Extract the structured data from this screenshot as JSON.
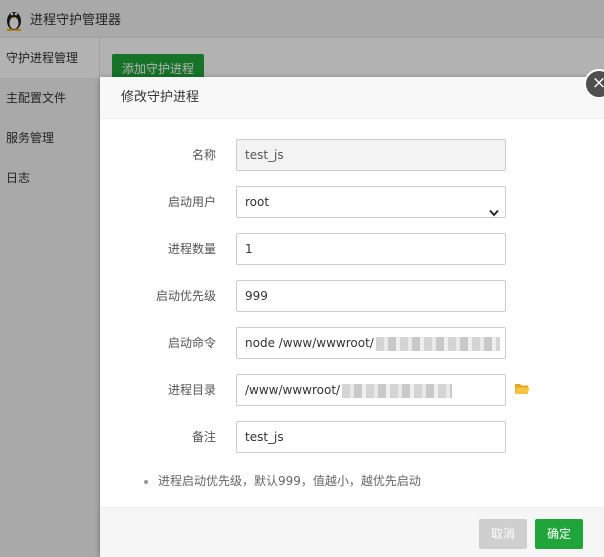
{
  "app": {
    "title": "进程守护管理器",
    "add_button": "添加守护进程"
  },
  "sidebar": {
    "items": [
      {
        "label": "守护进程管理"
      },
      {
        "label": "主配置文件"
      },
      {
        "label": "服务管理"
      },
      {
        "label": "日志"
      }
    ]
  },
  "dialog": {
    "title": "修改守护进程",
    "close_symbol": "×",
    "fields": {
      "name": {
        "label": "名称",
        "value": "test_js"
      },
      "user": {
        "label": "启动用户",
        "value": "root"
      },
      "count": {
        "label": "进程数量",
        "value": "1"
      },
      "priority": {
        "label": "启动优先级",
        "value": "999"
      },
      "command": {
        "label": "启动命令",
        "value": "node /www/wwwroot/"
      },
      "directory": {
        "label": "进程目录",
        "value": "/www/wwwroot/"
      },
      "remark": {
        "label": "备注",
        "value": "test_js"
      }
    },
    "note": "进程启动优先级，默认999，值越小，越优先启动",
    "cancel": "取消",
    "confirm": "确定"
  },
  "colors": {
    "accent": "#20a53a",
    "disabled": "#cfcfcf",
    "folder": "#f0c040"
  },
  "icons": {
    "logo": "penguin-icon",
    "folder": "folder-icon",
    "close": "close-icon",
    "select": "chevron-down-icon"
  }
}
